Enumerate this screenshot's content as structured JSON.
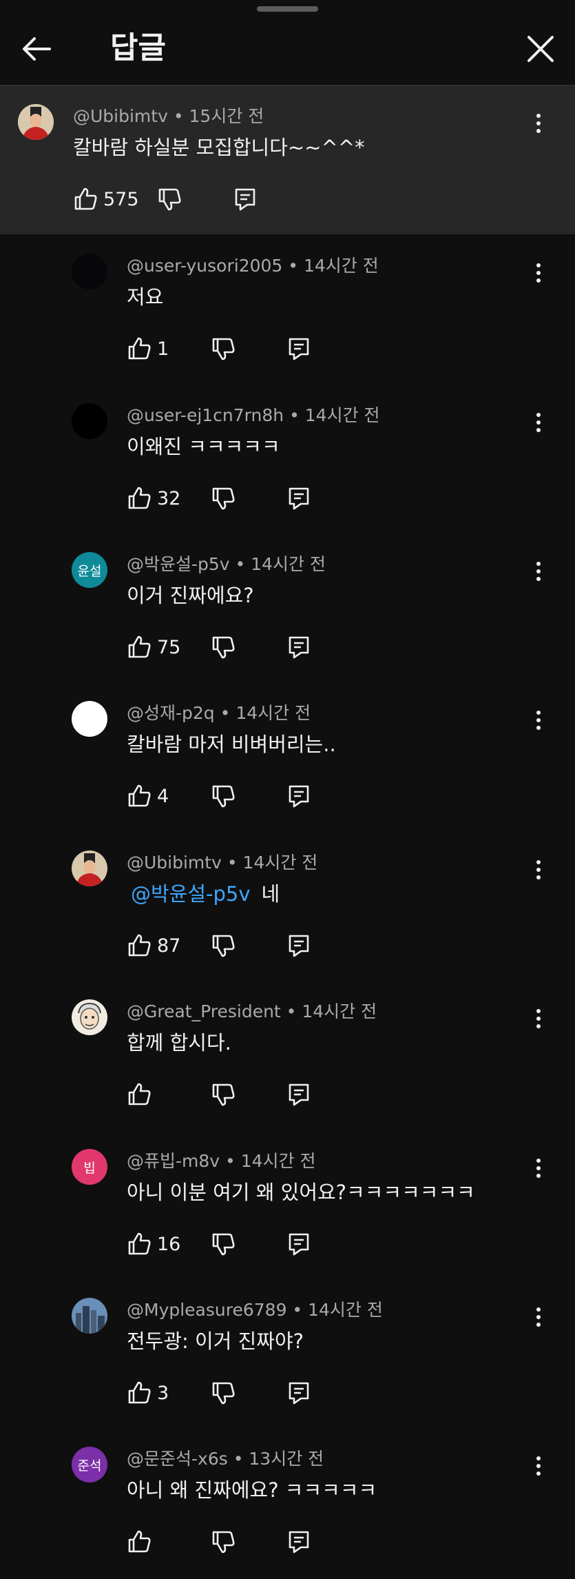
{
  "header": {
    "title": "답글"
  },
  "parent": {
    "author": "@Ubibimtv",
    "time": "15시간 전",
    "text": "칼바람 하실분 모집합니다~~^^*",
    "likes": "575"
  },
  "replies": [
    {
      "author": "@user-yusori2005",
      "time": "14시간 전",
      "text": "저요",
      "likes": "1"
    },
    {
      "author": "@user-ej1cn7rn8h",
      "time": "14시간 전",
      "text": "이왜진 ㅋㅋㅋㅋㅋ",
      "likes": "32"
    },
    {
      "author": "@박윤설-p5v",
      "time": "14시간 전",
      "text": "이거 진짜에요?",
      "likes": "75",
      "avatar_text": "윤설",
      "avatar_color": "#0f8a99"
    },
    {
      "author": "@성재-p2q",
      "time": "14시간 전",
      "text": "칼바람 마저 비벼버리는..",
      "likes": "4"
    },
    {
      "author": "@Ubibimtv",
      "time": "14시간 전",
      "mention": "@박윤설-p5v",
      "text": "네",
      "likes": "87"
    },
    {
      "author": "@Great_President",
      "time": "14시간 전",
      "text": "합께 합시다.",
      "likes": ""
    },
    {
      "author": "@퓨빕-m8v",
      "time": "14시간 전",
      "text": "아니 이분 여기 왜 있어요?ㅋㅋㅋㅋㅋㅋㅋ",
      "likes": "16",
      "avatar_text": "빕",
      "avatar_color": "#e0386d"
    },
    {
      "author": "@Mypleasure6789",
      "time": "14시간 전",
      "text": "전두광: 이거 진짜야?",
      "likes": "3"
    },
    {
      "author": "@문준석-x6s",
      "time": "13시간 전",
      "text": "아니 왜 진짜에요? ㅋㅋㅋㅋㅋ",
      "likes": "",
      "avatar_text": "준석",
      "avatar_color": "#7b2fa8"
    }
  ]
}
